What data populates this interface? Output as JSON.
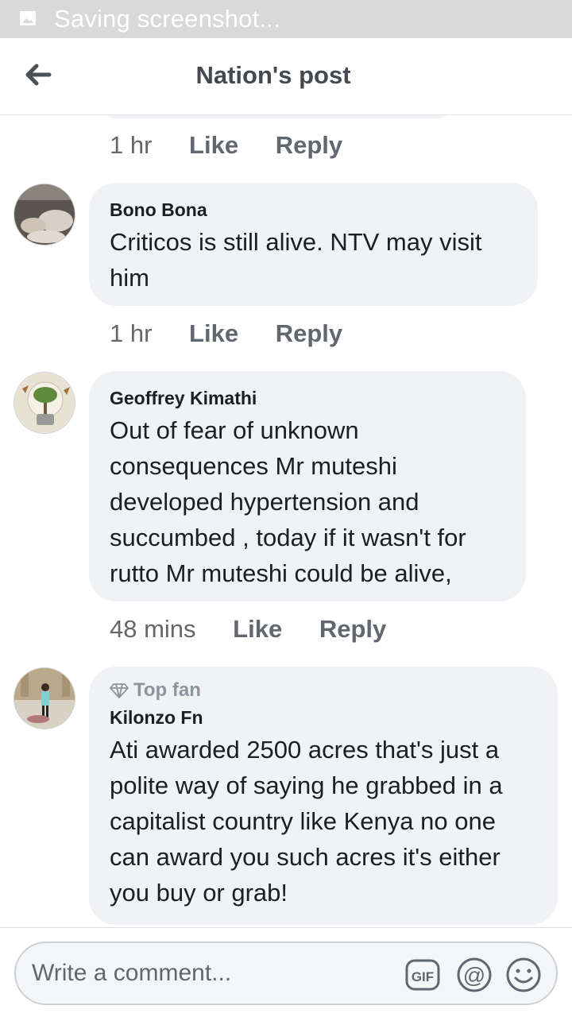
{
  "status_bar": {
    "text": "Saving screenshot..."
  },
  "header": {
    "title": "Nation's post"
  },
  "previous_comment": {
    "time": "1 hr",
    "like_label": "Like",
    "reply_label": "Reply"
  },
  "comments": [
    {
      "author": "Bono Bona",
      "text": "Criticos is still alive. NTV may visit him",
      "time": "1 hr",
      "like_label": "Like",
      "reply_label": "Reply"
    },
    {
      "author": "Geoffrey Kimathi",
      "text": "Out of fear of unknown consequences Mr muteshi developed hypertension and succumbed , today if it wasn't for rutto Mr muteshi could be alive,",
      "time": "48 mins",
      "like_label": "Like",
      "reply_label": "Reply"
    },
    {
      "badge": "Top fan",
      "author": "Kilonzo Fn",
      "text": "Ati awarded 2500 acres that's just a polite way of saying he grabbed in a capitalist country like Kenya no one can award you such acres it's either you buy or grab!"
    }
  ],
  "composer": {
    "placeholder": "Write a comment...",
    "icons": [
      "gif-icon",
      "mention-icon",
      "emoji-icon"
    ]
  },
  "colors": {
    "bubble": "#f0f2f5",
    "text": "#1c1e21",
    "secondary": "#606770",
    "status_bar": "#d9d9d9"
  }
}
